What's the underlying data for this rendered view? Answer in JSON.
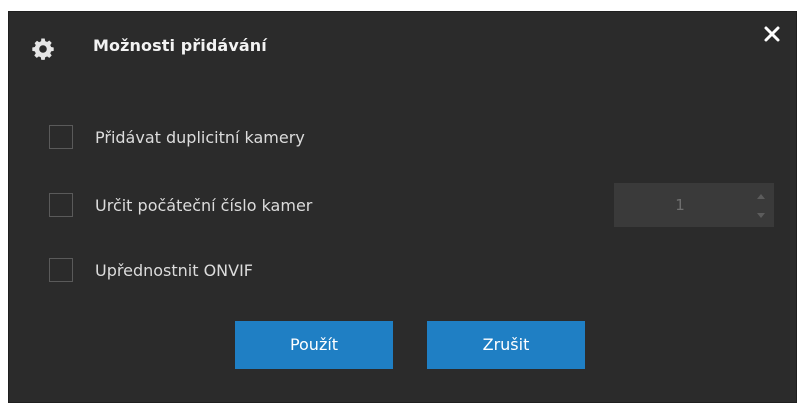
{
  "dialog": {
    "title": "Možnosti přidávání",
    "title_icon": "gear-icon",
    "close_icon": "close-icon"
  },
  "options": [
    {
      "label": "Přidávat duplicitní kamery",
      "checked": false
    },
    {
      "label": "Určit počáteční číslo kamer",
      "checked": false
    },
    {
      "label": "Upřednostnit ONVIF",
      "checked": false
    }
  ],
  "camera_start_number": {
    "value": "1",
    "enabled": false
  },
  "buttons": {
    "apply_label": "Použít",
    "cancel_label": "Zrušit"
  },
  "colors": {
    "dialog_background": "#2b2b2b",
    "button_accent": "#1f7fc4",
    "stepper_background": "#3a3a3a"
  }
}
